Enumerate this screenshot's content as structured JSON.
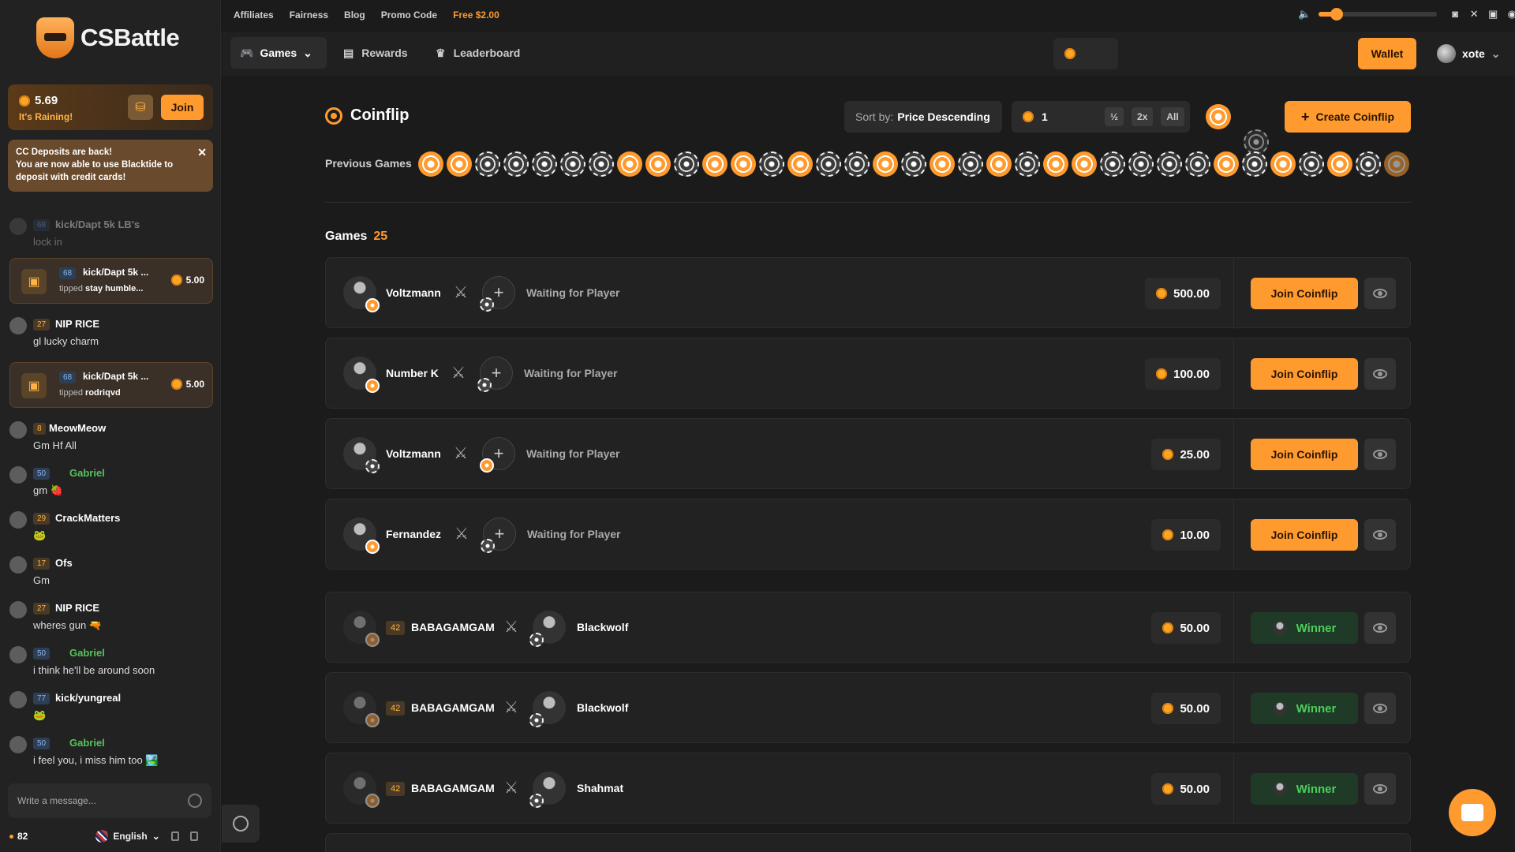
{
  "brand": {
    "name": "CSBattle"
  },
  "top_links": [
    "Affiliates",
    "Fairness",
    "Blog",
    "Promo Code",
    "Free $2.00"
  ],
  "volume_level": 0.15,
  "nav": {
    "games": "Games",
    "rewards": "Rewards",
    "leaderboard": "Leaderboard",
    "wallet": "Wallet",
    "username": "xote"
  },
  "rain": {
    "amount": "5.69",
    "label": "It's Raining!",
    "join": "Join"
  },
  "notice": {
    "title": "CC Deposits are back!",
    "body": "You are now able to use Blacktide to deposit with credit cards!"
  },
  "chat": {
    "faded": {
      "level": "68",
      "name": "kick/Dapt 5k LB's",
      "text": "lock in"
    },
    "tips": [
      {
        "level": "68",
        "name": "kick/Dapt 5k ...",
        "action": "tipped",
        "target": "stay humble...",
        "amount": "5.00"
      },
      {
        "level": "68",
        "name": "kick/Dapt 5k ...",
        "action": "tipped",
        "target": "rodriqvd",
        "amount": "5.00"
      }
    ],
    "messages": [
      {
        "level": "27",
        "name": "NIP RICE",
        "text": "gl lucky charm"
      },
      {
        "level": "8",
        "name": "MeowMeow",
        "text": "Gm Hf All"
      },
      {
        "level": "50",
        "name": "Gabriel",
        "text": "gm 🍓"
      },
      {
        "level": "29",
        "name": "CrackMatters",
        "text": "🐸"
      },
      {
        "level": "17",
        "name": "Ofs",
        "text": "Gm"
      },
      {
        "level": "27",
        "name": "NIP RICE",
        "text": "wheres gun 🔫"
      },
      {
        "level": "50",
        "name": "Gabriel",
        "text": "i think he'll be around soon"
      },
      {
        "level": "77",
        "name": "kick/yungreal",
        "text": "🐸"
      },
      {
        "level": "50",
        "name": "Gabriel",
        "text": "i feel you, i miss him too 🏞️"
      }
    ],
    "placeholder": "Write a message...",
    "online": "82",
    "language": "English"
  },
  "main": {
    "title": "Coinflip",
    "sort_prefix": "Sort by:",
    "sort_value": "Price Descending",
    "amount_value": "1",
    "half": "½",
    "double": "2x",
    "all": "All",
    "create": "Create Coinflip",
    "previous_label": "Previous Games",
    "previous_games": [
      "t",
      "t",
      "ct",
      "ct",
      "ct",
      "ct",
      "ct",
      "t",
      "t",
      "ct",
      "t",
      "t",
      "ct",
      "t",
      "ct",
      "ct",
      "t",
      "ct",
      "t",
      "ct",
      "t",
      "ct",
      "t",
      "t",
      "ct",
      "ct",
      "ct",
      "ct",
      "t",
      "ct",
      "t",
      "ct",
      "t",
      "ct",
      "t"
    ],
    "games_label": "Games",
    "games_count": "25"
  },
  "games": [
    {
      "player": "Voltzmann",
      "status": "Waiting for Player",
      "amount": "500.00",
      "action": "Join Coinflip"
    },
    {
      "player": "Number K",
      "status": "Waiting for Player",
      "amount": "100.00",
      "action": "Join Coinflip"
    },
    {
      "player": "Voltzmann",
      "status": "Waiting for Player",
      "amount": "25.00",
      "action": "Join Coinflip"
    },
    {
      "player": "Fernandez",
      "status": "Waiting for Player",
      "amount": "10.00",
      "action": "Join Coinflip"
    },
    {
      "level": "42",
      "player": "BABAGAMGAM",
      "opponent": "Blackwolf",
      "amount": "50.00",
      "result": "Winner"
    },
    {
      "level": "42",
      "player": "BABAGAMGAM",
      "opponent": "Blackwolf",
      "amount": "50.00",
      "result": "Winner"
    },
    {
      "level": "42",
      "player": "BABAGAMGAM",
      "opponent": "Shahmat",
      "amount": "50.00",
      "result": "Winner"
    }
  ]
}
